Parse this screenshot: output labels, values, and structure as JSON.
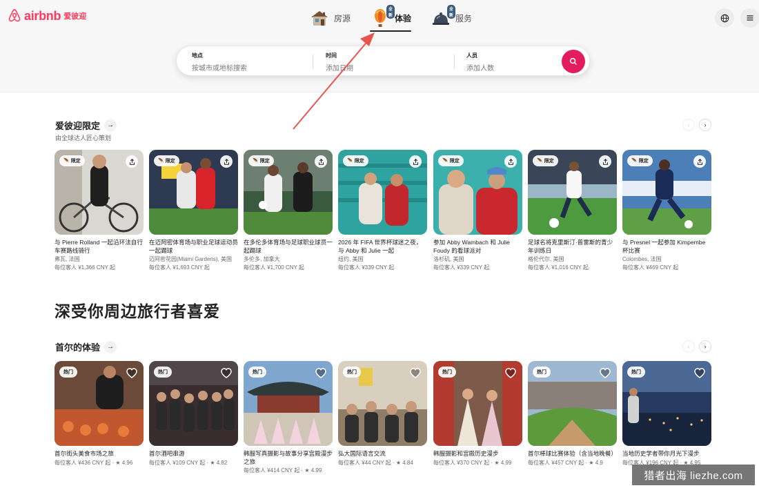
{
  "header": {
    "logo_text": "airbnb",
    "logo_cn": "爱彼迎",
    "nav": [
      {
        "label": "房源",
        "active": false,
        "new_badge": ""
      },
      {
        "label": "体验",
        "active": true,
        "new_badge": "全新"
      },
      {
        "label": "服务",
        "active": false,
        "new_badge": "全新"
      }
    ]
  },
  "search": {
    "where_label": "地点",
    "where_placeholder": "按城市或地标搜索",
    "when_label": "时间",
    "when_placeholder": "添加日期",
    "who_label": "人员",
    "who_placeholder": "添加人数"
  },
  "section1": {
    "title": "爱彼迎限定",
    "subtitle": "由全球达人匠心策划",
    "badge": "限定",
    "cards": [
      {
        "title": "与 Pierre Rolland 一起沿环法自行车赛路线骑行",
        "loc": "弗瓦, 法国",
        "price": "每位客人 ¥1,366 CNY 起"
      },
      {
        "title": "在迈阿密体育场与职业足球运动员一起踢球",
        "loc": "迈阿密花园(Miami Gardens), 美国",
        "price": "每位客人 ¥1,693 CNY 起"
      },
      {
        "title": "在多伦多体育场与足球职业球员一起踢球",
        "loc": "多伦多, 加拿大",
        "price": "每位客人 ¥1,700 CNY 起"
      },
      {
        "title": "2026 年 FIFA 世界杯球迷之夜，与 Abby 和 Julie 一起",
        "loc": "纽约, 美国",
        "price": "每位客人 ¥339 CNY 起"
      },
      {
        "title": "参加 Abby Wambach 和 Julie Foudy 的看球派对",
        "loc": "洛杉矶, 美国",
        "price": "每位客人 ¥339 CNY 起"
      },
      {
        "title": "足球名将克里斯汀·普雷斯的青少年训练日",
        "loc": "格伦代尔, 美国",
        "price": "每位客人 ¥1,016 CNY 起"
      },
      {
        "title": "与 Presnel 一起参加 Kimpembe 杯比赛",
        "loc": "Colombes, 法国",
        "price": "每位客人 ¥469 CNY 起"
      }
    ]
  },
  "big_title": "深受你周边旅行者喜爱",
  "section2": {
    "title": "首尔的体验",
    "badge": "热门",
    "cards": [
      {
        "title": "首尔街头美食市场之旅",
        "price": "每位客人 ¥436 CNY 起 · ★ 4.96"
      },
      {
        "title": "首尔酒吧串游",
        "price": "每位客人 ¥109 CNY 起 · ★ 4.82"
      },
      {
        "title": "韩服写真摄影与故事分享宫殿漫步之旅",
        "price": "每位客人 ¥414 CNY 起 · ★ 4.99"
      },
      {
        "title": "弘大国际语言交流",
        "price": "每位客人 ¥44 CNY 起 · ★ 4.84"
      },
      {
        "title": "韩服摄影和宫殿历史漫步",
        "price": "每位客人 ¥370 CNY 起 · ★ 4.99"
      },
      {
        "title": "首尔棒球比赛体验（含当地晚餐）",
        "price": "每位客人 ¥457 CNY 起 · ★ 4.9"
      },
      {
        "title": "当地历史学者带你月光下漫步",
        "price": "每位客人 ¥196 CNY 起 · ★ 4.95"
      }
    ]
  },
  "watermark": "猎者出海 liezhe.com",
  "colors": {
    "brand": "#ff385c",
    "search_button": "#e31c5f",
    "annotation": "#e8554e"
  }
}
